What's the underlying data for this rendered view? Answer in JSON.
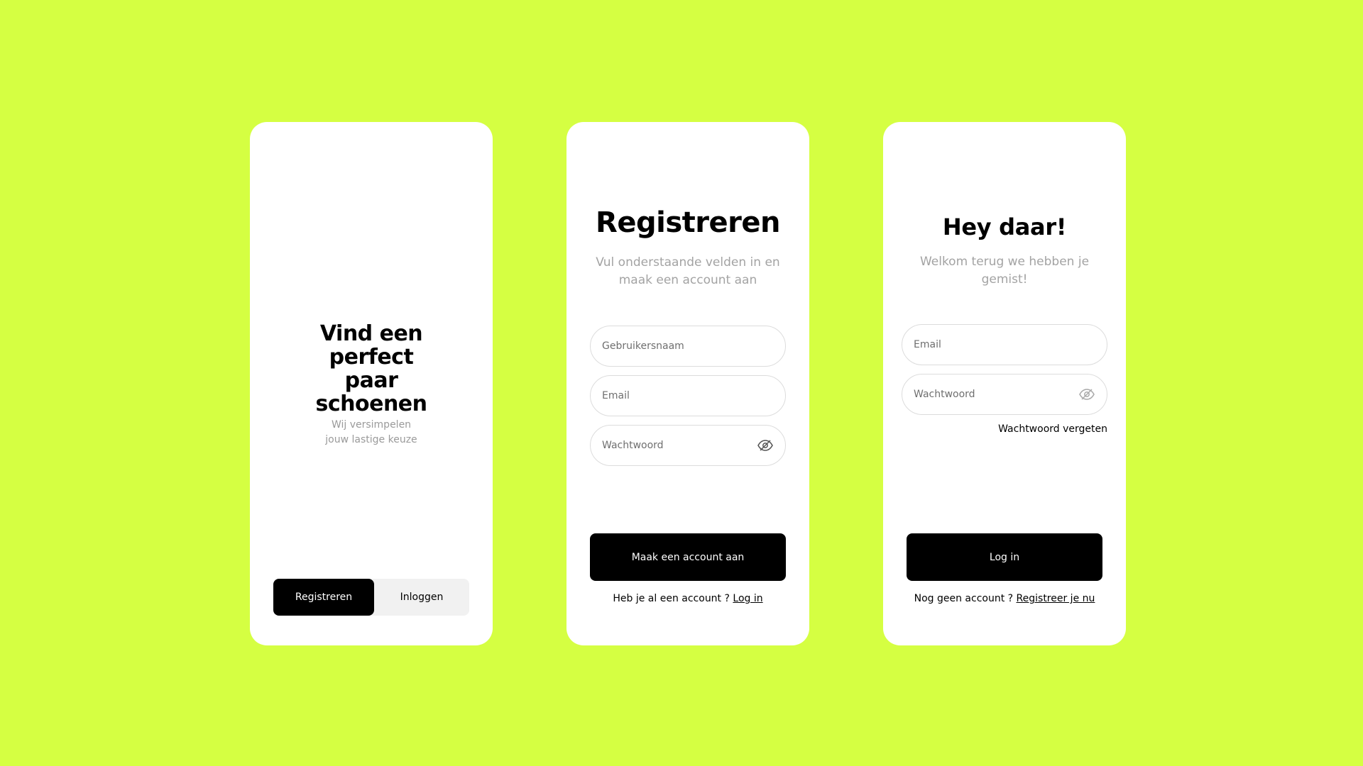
{
  "colors": {
    "background": "#d5ff42",
    "card": "#ffffff",
    "primary": "#000000",
    "muted_text": "#a3a3a3"
  },
  "welcome": {
    "title": "Vind een perfect paar schoenen",
    "subtitle": "Wij versimpelen jouw lastige keuze",
    "register_button": "Registreren",
    "login_button": "Inloggen",
    "active_tab": "Registreren"
  },
  "register": {
    "title": "Registreren",
    "subtitle": "Vul onderstaande velden in en maak een account aan",
    "username_placeholder": "Gebruikersnaam",
    "email_placeholder": "Email",
    "password_placeholder": "Wachtwoord",
    "password_toggle_icon": "eye-off-icon",
    "submit_label": "Maak een account aan",
    "footer_text": "Heb je al een account ?",
    "footer_link": "Log in"
  },
  "login": {
    "title": "Hey daar!",
    "subtitle": "Welkom terug we hebben je gemist!",
    "email_placeholder": "Email",
    "password_placeholder": "Wachtwoord",
    "password_toggle_icon": "eye-off-icon",
    "forgot_label": "Wachtwoord vergeten",
    "submit_label": "Log in",
    "footer_text": "Nog geen account ?",
    "footer_link": "Registreer je nu"
  }
}
